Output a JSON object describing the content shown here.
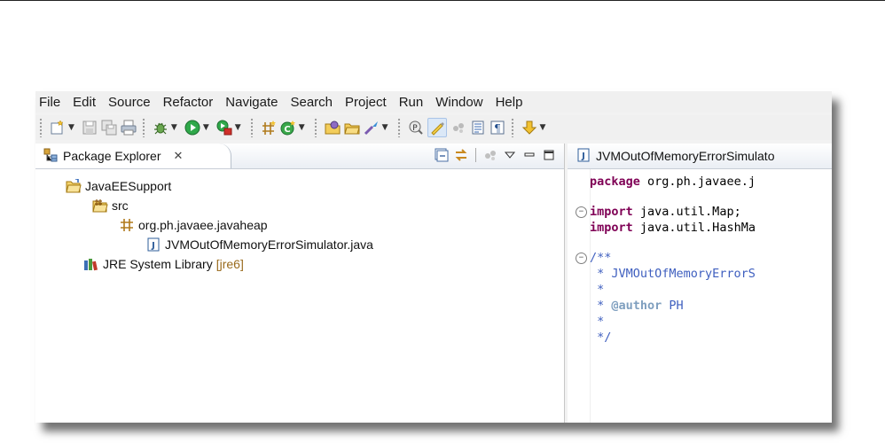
{
  "menu": [
    "File",
    "Edit",
    "Source",
    "Refactor",
    "Navigate",
    "Search",
    "Project",
    "Run",
    "Window",
    "Help"
  ],
  "package_explorer": {
    "tab_title": "Package Explorer",
    "close_glyph": "✕",
    "tree": {
      "project": "JavaEESupport",
      "src": "src",
      "package": "org.ph.javaee.javaheap",
      "file": "JVMOutOfMemoryErrorSimulator.java",
      "library": "JRE System Library",
      "library_decoration": "[jre6]"
    }
  },
  "editor": {
    "tab_title": "JVMOutOfMemoryErrorSimulato",
    "lines": {
      "l1_kw": "package",
      "l1_rest": " org.ph.javaee.j",
      "l3_kw": "import",
      "l3_rest": " java.util.Map;",
      "l4_kw": "import",
      "l4_rest": " java.util.HashMa",
      "l6": "/**",
      "l7": " * JVMOutOfMemoryErrorS",
      "l8": " *",
      "l9_pre": " * ",
      "l9_tag": "@author",
      "l9_rest": " PH",
      "l10": " *",
      "l11": " */"
    }
  },
  "icons": {
    "toolbar": [
      "new-wizard-icon",
      "save-icon",
      "save-all-icon",
      "print-icon",
      "debug-icon",
      "run-icon",
      "run-external-tools-icon",
      "new-java-package-icon",
      "new-java-class-icon",
      "open-type-icon",
      "open-task-icon",
      "search-icon",
      "toggle-mark-occurrences-icon",
      "highlight-icon",
      "block-selection-icon",
      "show-whitespace-icon",
      "show-source-icon",
      "next-annotation-icon"
    ]
  },
  "colors": {
    "keyword": "#7f0055",
    "javadoc": "#3f5fbf",
    "javadoc_tag": "#7f9fbf",
    "decoration": "#9a6b1e"
  }
}
